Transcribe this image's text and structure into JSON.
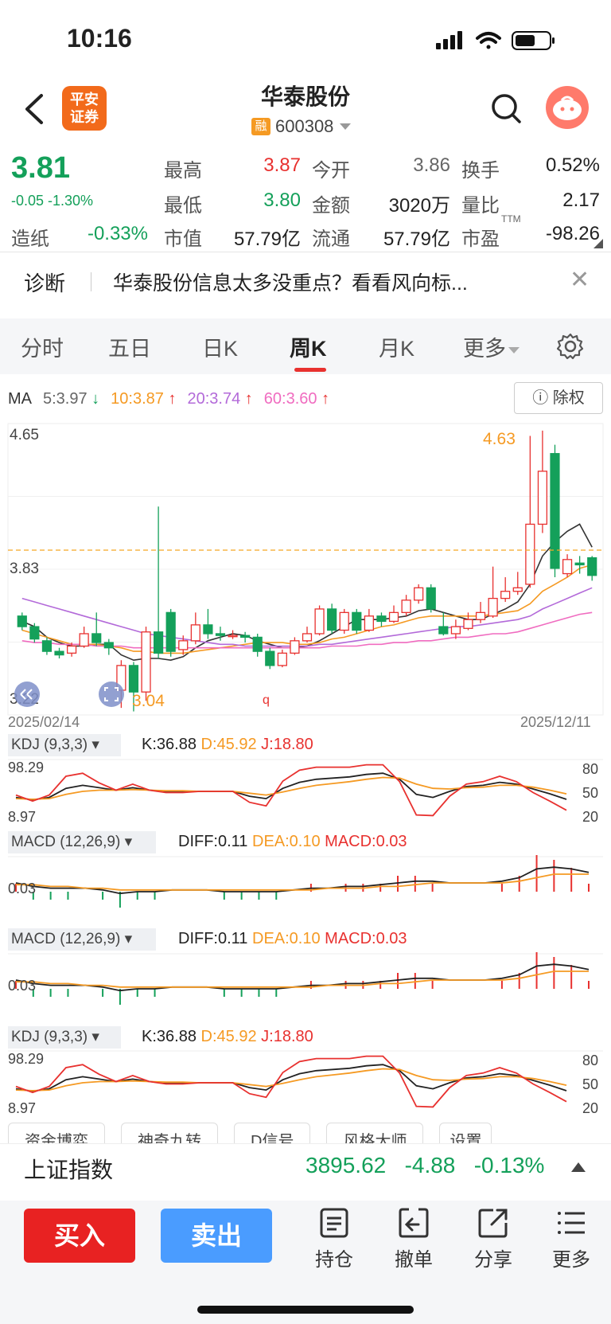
{
  "status_bar": {
    "time": "10:16"
  },
  "header": {
    "logo_text_1": "平安",
    "logo_text_2": "证券",
    "title": "华泰股份",
    "badge": "融",
    "code": "600308"
  },
  "quote": {
    "price": "3.81",
    "change": "-0.05 -1.30%",
    "high_label": "最高",
    "high": "3.87",
    "open_label": "今开",
    "open": "3.86",
    "turnover_label": "换手",
    "turnover": "0.52%",
    "low_label": "最低",
    "low": "3.80",
    "amount_label": "金额",
    "amount": "3020万",
    "vol_ratio_label": "量比",
    "vol_ratio": "2.17",
    "sector_label": "造纸",
    "sector": "-0.33%",
    "mcap_label": "市值",
    "mcap": "57.79亿",
    "float_label": "流通",
    "float": "57.79亿",
    "pe_label": "市盈",
    "pe_sup": "TTM",
    "pe": "-98.26"
  },
  "diagnose": {
    "label": "诊断",
    "text": "华泰股份信息太多没重点？看看风向标..."
  },
  "tabs": [
    "分时",
    "五日",
    "日K",
    "周K",
    "月K",
    "更多"
  ],
  "active_tab": "周K",
  "ma": {
    "name": "MA",
    "ma5": "5:3.97",
    "ma10": "10:3.87",
    "ma20": "20:3.74",
    "ma60": "60:3.60",
    "fuquan": "除权"
  },
  "chart_data": {
    "type": "candlestick",
    "period": "weekly",
    "y_top_label": "4.65",
    "y_mid_label": "3.83",
    "y_bottom_label": "3.22",
    "max_annotation": "4.63",
    "min_annotation": "3.04",
    "x_start": "2025/02/14",
    "x_end": "2025/12/11",
    "ylim": [
      3.02,
      4.67
    ],
    "candles": [
      [
        3.58,
        3.52,
        3.6,
        3.5
      ],
      [
        3.52,
        3.45,
        3.54,
        3.43
      ],
      [
        3.44,
        3.38,
        3.46,
        3.36
      ],
      [
        3.38,
        3.36,
        3.4,
        3.34
      ],
      [
        3.37,
        3.41,
        3.43,
        3.35
      ],
      [
        3.41,
        3.48,
        3.52,
        3.4
      ],
      [
        3.48,
        3.43,
        3.6,
        3.41
      ],
      [
        3.43,
        3.4,
        3.45,
        3.36
      ],
      [
        3.16,
        3.3,
        3.33,
        3.06
      ],
      [
        3.3,
        3.15,
        3.32,
        3.04
      ],
      [
        3.15,
        3.49,
        3.52,
        3.1
      ],
      [
        3.49,
        3.37,
        4.2,
        3.34
      ],
      [
        3.6,
        3.38,
        3.62,
        3.35
      ],
      [
        3.39,
        3.44,
        3.47,
        3.36
      ],
      [
        3.44,
        3.53,
        3.6,
        3.42
      ],
      [
        3.53,
        3.48,
        3.62,
        3.45
      ],
      [
        3.48,
        3.47,
        3.52,
        3.44
      ],
      [
        3.47,
        3.47,
        3.5,
        3.45
      ],
      [
        3.47,
        3.46,
        3.49,
        3.43
      ],
      [
        3.46,
        3.38,
        3.48,
        3.35
      ],
      [
        3.38,
        3.3,
        3.4,
        3.28
      ],
      [
        3.3,
        3.37,
        3.39,
        3.29
      ],
      [
        3.37,
        3.44,
        3.46,
        3.36
      ],
      [
        3.44,
        3.48,
        3.52,
        3.43
      ],
      [
        3.48,
        3.62,
        3.64,
        3.47
      ],
      [
        3.62,
        3.5,
        3.65,
        3.48
      ],
      [
        3.5,
        3.6,
        3.62,
        3.48
      ],
      [
        3.6,
        3.5,
        3.62,
        3.48
      ],
      [
        3.5,
        3.58,
        3.62,
        3.49
      ],
      [
        3.58,
        3.55,
        3.6,
        3.52
      ],
      [
        3.55,
        3.6,
        3.64,
        3.54
      ],
      [
        3.6,
        3.67,
        3.7,
        3.58
      ],
      [
        3.67,
        3.74,
        3.76,
        3.65
      ],
      [
        3.74,
        3.62,
        3.76,
        3.6
      ],
      [
        3.52,
        3.48,
        3.6,
        3.47
      ],
      [
        3.48,
        3.52,
        3.56,
        3.45
      ],
      [
        3.51,
        3.56,
        3.6,
        3.5
      ],
      [
        3.56,
        3.6,
        3.66,
        3.54
      ],
      [
        3.58,
        3.68,
        3.86,
        3.57
      ],
      [
        3.68,
        3.72,
        3.8,
        3.66
      ],
      [
        3.72,
        3.74,
        3.83,
        3.7
      ],
      [
        3.76,
        4.1,
        4.6,
        3.74
      ],
      [
        4.1,
        4.4,
        4.63,
        4.05
      ],
      [
        4.5,
        3.85,
        4.55,
        3.8
      ],
      [
        3.82,
        3.9,
        3.93,
        3.8
      ],
      [
        3.88,
        3.87,
        3.92,
        3.82
      ],
      [
        3.91,
        3.81,
        3.92,
        3.78
      ]
    ],
    "ma_values": {
      "ma5": [
        3.55,
        3.52,
        3.46,
        3.43,
        3.41,
        3.41,
        3.42,
        3.42,
        3.36,
        3.33,
        3.34,
        3.34,
        3.33,
        3.35,
        3.4,
        3.44,
        3.46,
        3.48,
        3.47,
        3.44,
        3.42,
        3.4,
        3.4,
        3.41,
        3.44,
        3.48,
        3.52,
        3.56,
        3.56,
        3.56,
        3.57,
        3.58,
        3.61,
        3.62,
        3.6,
        3.58,
        3.56,
        3.56,
        3.59,
        3.62,
        3.66,
        3.76,
        3.92,
        4.0,
        4.06,
        4.1,
        3.97
      ],
      "ma10": [
        3.5,
        3.48,
        3.46,
        3.44,
        3.42,
        3.42,
        3.42,
        3.41,
        3.4,
        3.38,
        3.38,
        3.37,
        3.37,
        3.37,
        3.38,
        3.39,
        3.4,
        3.41,
        3.42,
        3.43,
        3.43,
        3.43,
        3.42,
        3.42,
        3.43,
        3.45,
        3.46,
        3.48,
        3.5,
        3.52,
        3.53,
        3.55,
        3.57,
        3.58,
        3.58,
        3.58,
        3.58,
        3.58,
        3.59,
        3.6,
        3.61,
        3.65,
        3.72,
        3.76,
        3.8,
        3.85,
        3.87
      ],
      "ma20": [
        3.68,
        3.66,
        3.64,
        3.62,
        3.6,
        3.58,
        3.56,
        3.54,
        3.52,
        3.5,
        3.48,
        3.47,
        3.46,
        3.45,
        3.44,
        3.43,
        3.42,
        3.42,
        3.41,
        3.41,
        3.41,
        3.41,
        3.41,
        3.41,
        3.42,
        3.42,
        3.43,
        3.44,
        3.45,
        3.46,
        3.47,
        3.48,
        3.49,
        3.5,
        3.51,
        3.52,
        3.52,
        3.53,
        3.54,
        3.55,
        3.56,
        3.58,
        3.62,
        3.65,
        3.68,
        3.71,
        3.74
      ],
      "ma60": [
        3.44,
        3.43,
        3.43,
        3.42,
        3.42,
        3.42,
        3.41,
        3.41,
        3.41,
        3.4,
        3.4,
        3.4,
        3.4,
        3.4,
        3.4,
        3.4,
        3.4,
        3.4,
        3.4,
        3.4,
        3.4,
        3.4,
        3.4,
        3.4,
        3.4,
        3.41,
        3.41,
        3.41,
        3.42,
        3.42,
        3.43,
        3.43,
        3.44,
        3.44,
        3.45,
        3.46,
        3.46,
        3.47,
        3.48,
        3.48,
        3.49,
        3.51,
        3.53,
        3.55,
        3.57,
        3.59,
        3.6
      ]
    },
    "kdj": {
      "k": [
        40,
        36,
        40,
        55,
        60,
        56,
        52,
        56,
        52,
        50,
        50,
        50,
        50,
        50,
        42,
        38,
        55,
        65,
        70,
        72,
        74,
        78,
        80,
        70,
        45,
        40,
        50,
        58,
        60,
        65,
        62,
        54,
        46,
        36.88
      ],
      "d": [
        38,
        37,
        38,
        45,
        50,
        52,
        52,
        53,
        52,
        51,
        51,
        50,
        50,
        50,
        47,
        44,
        49,
        55,
        60,
        63,
        66,
        70,
        73,
        72,
        62,
        55,
        54,
        56,
        57,
        60,
        60,
        57,
        52,
        45.92
      ],
      "j": [
        44,
        34,
        44,
        75,
        80,
        64,
        52,
        62,
        52,
        48,
        48,
        50,
        50,
        50,
        32,
        26,
        67,
        85,
        90,
        90,
        90,
        94,
        94,
        66,
        11,
        10,
        42,
        62,
        66,
        75,
        66,
        48,
        34,
        18.8
      ]
    },
    "macd": {
      "diff": [
        0.05,
        0.03,
        0.02,
        0.02,
        0.02,
        0.01,
        -0.01,
        0.0,
        0.0,
        0.01,
        0.01,
        0.01,
        0.0,
        0.0,
        0.0,
        0.0,
        0.01,
        0.02,
        0.02,
        0.03,
        0.03,
        0.04,
        0.05,
        0.06,
        0.06,
        0.05,
        0.05,
        0.05,
        0.06,
        0.08,
        0.13,
        0.14,
        0.13,
        0.11
      ],
      "dea": [
        0.04,
        0.04,
        0.03,
        0.03,
        0.02,
        0.02,
        0.01,
        0.01,
        0.01,
        0.01,
        0.01,
        0.01,
        0.01,
        0.01,
        0.01,
        0.01,
        0.01,
        0.01,
        0.02,
        0.02,
        0.02,
        0.03,
        0.03,
        0.04,
        0.05,
        0.05,
        0.05,
        0.05,
        0.05,
        0.06,
        0.08,
        0.1,
        0.1,
        0.1
      ]
    }
  },
  "kdj_panel": {
    "name": "KDJ (9,3,3)",
    "k": "K:36.88",
    "d": "D:45.92",
    "j": "J:18.80",
    "top": "98.29",
    "bottom": "8.97",
    "r80": "80",
    "r50": "50",
    "r20": "20"
  },
  "macd_panel": {
    "name": "MACD (12,26,9)",
    "diff": "DIFF:0.11",
    "dea": "DEA:0.10",
    "macd": "MACD:0.03",
    "level": "0.03"
  },
  "tools": [
    "资金博弈",
    "神奇九转",
    "D信号",
    "风格大师",
    "设置"
  ],
  "index": {
    "name": "上证指数",
    "value": "3895.62",
    "change": "-4.88",
    "pct": "-0.13%"
  },
  "bottom_bar": {
    "buy": "买入",
    "sell": "卖出",
    "hold": "持仓",
    "cancel": "撤单",
    "share": "分享",
    "more": "更多"
  },
  "colors": {
    "up": "#e8312f",
    "down": "#14a05a",
    "ma5": "#333333",
    "ma10": "#f59a23",
    "ma20": "#b36ad9",
    "ma60": "#f06cc0"
  }
}
